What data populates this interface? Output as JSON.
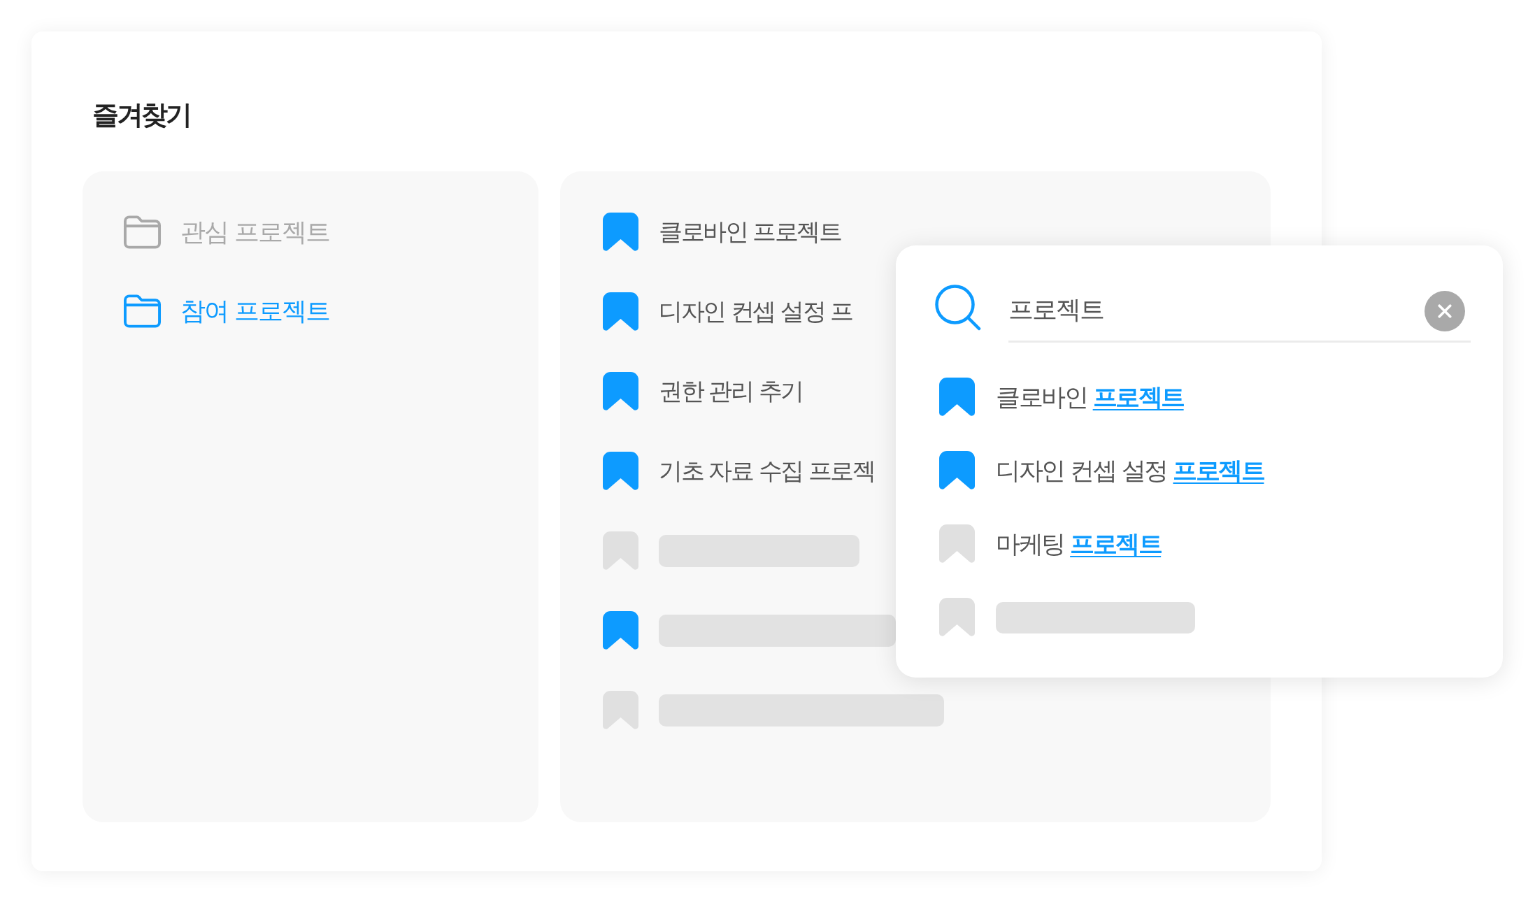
{
  "title": "즐겨찾기",
  "folders": [
    {
      "label": "관심 프로젝트",
      "selected": false
    },
    {
      "label": "참여 프로젝트",
      "selected": true
    }
  ],
  "bookmarks": [
    {
      "kind": "item",
      "label": "클로바인 프로젝트",
      "bookmarked": true
    },
    {
      "kind": "item",
      "label": "디자인 컨셉 설정 프",
      "bookmarked": true
    },
    {
      "kind": "item",
      "label": "권한 관리 추기",
      "bookmarked": true
    },
    {
      "kind": "item",
      "label": "기초 자료 수집 프로젝",
      "bookmarked": true
    },
    {
      "kind": "placeholder",
      "bookmarked": false
    },
    {
      "kind": "placeholder",
      "bookmarked": true
    },
    {
      "kind": "placeholder",
      "bookmarked": false
    }
  ],
  "search_popup": {
    "query": "프로젝트",
    "results": [
      {
        "kind": "item",
        "label": "클로바인 **프로젝트**",
        "bookmarked": true
      },
      {
        "kind": "item",
        "label": "디자인 컨셉 설정 **프로젝트**",
        "bookmarked": true
      },
      {
        "kind": "item",
        "label": "마케팅 **프로젝트**",
        "bookmarked": false
      },
      {
        "kind": "placeholder",
        "bookmarked": false
      }
    ]
  }
}
